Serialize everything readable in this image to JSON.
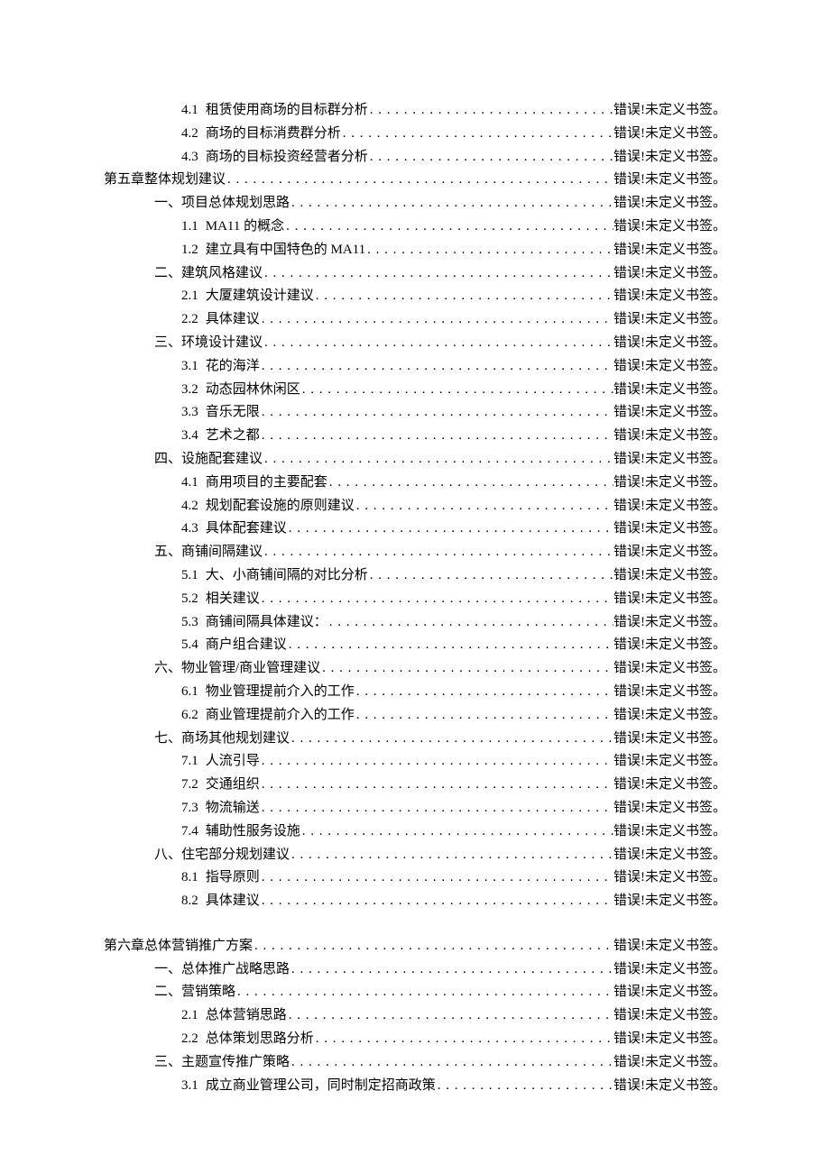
{
  "error_text": "错误!未定义书签。",
  "entries": [
    {
      "level": 2,
      "num": "4.1",
      "title": "租赁使用商场的目标群分析"
    },
    {
      "level": 2,
      "num": "4.2",
      "title": "商场的目标消费群分析"
    },
    {
      "level": 2,
      "num": "4.3",
      "title": "商场的目标投资经营者分析"
    },
    {
      "level": 0,
      "num": "",
      "title": "第五章整体规划建议"
    },
    {
      "level": 1,
      "num": "",
      "title": "一、项目总体规划思路"
    },
    {
      "level": 2,
      "num": "1.1",
      "title": "MA11 的概念"
    },
    {
      "level": 2,
      "num": "1.2",
      "title": "建立具有中国特色的 MA11"
    },
    {
      "level": 1,
      "num": "",
      "title": "二、建筑风格建议"
    },
    {
      "level": 2,
      "num": "2.1",
      "title": "大厦建筑设计建议"
    },
    {
      "level": 2,
      "num": "2.2",
      "title": "具体建议"
    },
    {
      "level": 1,
      "num": "",
      "title": "三、环境设计建议"
    },
    {
      "level": 2,
      "num": "3.1",
      "title": "花的海洋"
    },
    {
      "level": 2,
      "num": "3.2",
      "title": "动态园林休闲区"
    },
    {
      "level": 2,
      "num": "3.3",
      "title": "音乐无限"
    },
    {
      "level": 2,
      "num": "3.4",
      "title": "艺术之都"
    },
    {
      "level": 1,
      "num": "",
      "title": "四、设施配套建议"
    },
    {
      "level": 2,
      "num": "4.1",
      "title": "商用项目的主要配套"
    },
    {
      "level": 2,
      "num": "4.2",
      "title": "规划配套设施的原则建议"
    },
    {
      "level": 2,
      "num": "4.3",
      "title": "具体配套建议"
    },
    {
      "level": 1,
      "num": "",
      "title": "五、商铺间隔建议"
    },
    {
      "level": 2,
      "num": "5.1",
      "title": "大、小商铺间隔的对比分析"
    },
    {
      "level": 2,
      "num": "5.2",
      "title": "相关建议"
    },
    {
      "level": 2,
      "num": "5.3",
      "title": "商铺间隔具体建议："
    },
    {
      "level": 2,
      "num": "5.4",
      "title": "商户组合建议"
    },
    {
      "level": 1,
      "num": "",
      "title": "六、物业管理/商业管理建议"
    },
    {
      "level": 2,
      "num": "6.1",
      "title": "物业管理提前介入的工作"
    },
    {
      "level": 2,
      "num": "6.2",
      "title": "商业管理提前介入的工作"
    },
    {
      "level": 1,
      "num": "",
      "title": "七、商场其他规划建议"
    },
    {
      "level": 2,
      "num": "7.1",
      "title": "人流引导"
    },
    {
      "level": 2,
      "num": "7.2",
      "title": "交通组织"
    },
    {
      "level": 2,
      "num": "7.3",
      "title": "物流输送"
    },
    {
      "level": 2,
      "num": "7.4",
      "title": "辅助性服务设施"
    },
    {
      "level": 1,
      "num": "",
      "title": "八、住宅部分规划建议"
    },
    {
      "level": 2,
      "num": "8.1",
      "title": "指导原则"
    },
    {
      "level": 2,
      "num": "8.2",
      "title": "具体建议"
    },
    {
      "spacer": true
    },
    {
      "level": 0,
      "num": "",
      "title": "第六章总体营销推广方案"
    },
    {
      "level": 1,
      "num": "",
      "title": "一、总体推广战略思路"
    },
    {
      "level": 1,
      "num": "",
      "title": "二、营销策略"
    },
    {
      "level": 2,
      "num": "2.1",
      "title": "总体营销思路"
    },
    {
      "level": 2,
      "num": "2.2",
      "title": "总体策划思路分析"
    },
    {
      "level": 1,
      "num": "",
      "title": "三、主题宣传推广策略"
    },
    {
      "level": 2,
      "num": "3.1",
      "title": "成立商业管理公司，同时制定招商政策"
    }
  ]
}
